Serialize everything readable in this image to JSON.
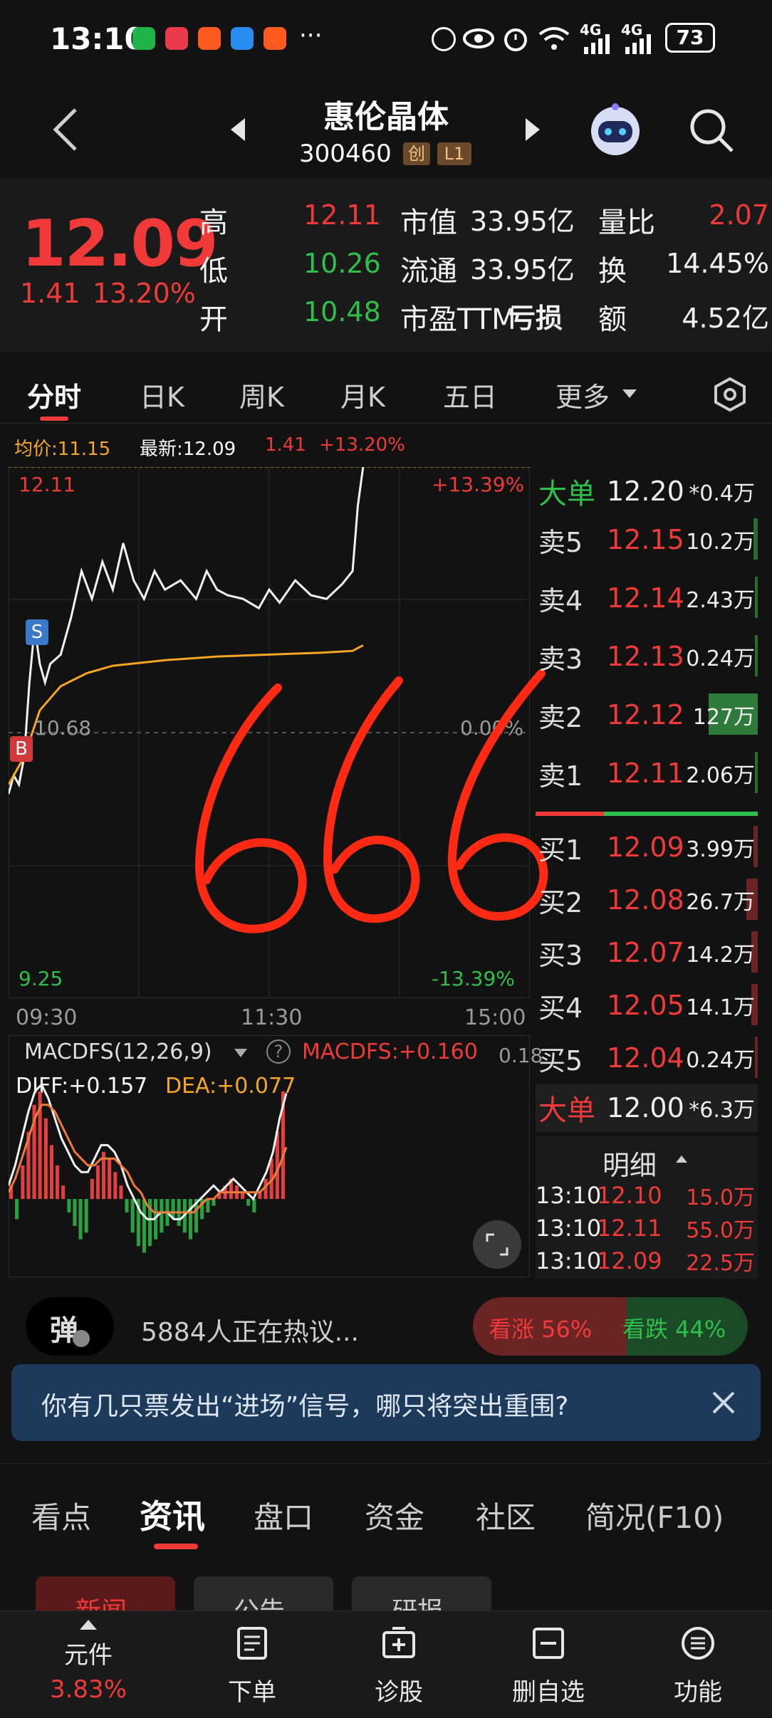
{
  "status_bar": {
    "time": "13:10",
    "signal_1": "4G",
    "signal_2": "4G",
    "battery": "73"
  },
  "nav": {
    "stock_name": "惠伦晶体",
    "stock_code": "300460",
    "badge_board": "创",
    "badge_level": "L1"
  },
  "quote": {
    "price": "12.09",
    "change": "1.41",
    "change_pct": "13.20%",
    "rows": [
      {
        "l1": "高",
        "v1": "12.11",
        "l2": "市值",
        "v2": "33.95亿",
        "l3": "量比",
        "v3": "2.07"
      },
      {
        "l1": "低",
        "v1": "10.26",
        "l2": "流通",
        "v2": "33.95亿",
        "l3": "换",
        "v3": "14.45%"
      },
      {
        "l1": "开",
        "v1": "10.48",
        "l2": "市盈TTM",
        "v2": "亏损",
        "l3": "额",
        "v3": "4.52亿"
      }
    ],
    "colors": {
      "up": "#f03a3a",
      "down": "#2fbf4a"
    }
  },
  "chart_tabs": [
    "分时",
    "日K",
    "周K",
    "月K",
    "五日",
    "更多"
  ],
  "chart_tabs_active": 0,
  "intraday": {
    "avg_label": "均价:11.15",
    "latest_label": "最新:12.09",
    "latest_change": "1.41",
    "latest_pct": "+13.20%",
    "price_top": "12.11",
    "price_mid": "10.68",
    "price_bottom": "9.25",
    "pct_top": "+13.39%",
    "pct_mid": "0.00%",
    "pct_bottom": "-13.39%",
    "time_start": "09:30",
    "time_mid": "11:30",
    "time_end": "15:00",
    "marker_sell": "S",
    "marker_buy": "B",
    "annotation": "666"
  },
  "chart_data": {
    "type": "line",
    "title": "",
    "series": [
      {
        "name": "最新",
        "color": "#f2f2f2",
        "points": [
          [
            0,
            10.35
          ],
          [
            0.01,
            10.45
          ],
          [
            0.02,
            10.4
          ],
          [
            0.03,
            10.55
          ],
          [
            0.04,
            10.95
          ],
          [
            0.05,
            11.25
          ],
          [
            0.06,
            11.05
          ],
          [
            0.07,
            10.95
          ],
          [
            0.08,
            11.05
          ],
          [
            0.1,
            11.1
          ],
          [
            0.12,
            11.3
          ],
          [
            0.14,
            11.55
          ],
          [
            0.16,
            11.4
          ],
          [
            0.18,
            11.6
          ],
          [
            0.2,
            11.45
          ],
          [
            0.22,
            11.7
          ],
          [
            0.24,
            11.5
          ],
          [
            0.26,
            11.4
          ],
          [
            0.28,
            11.55
          ],
          [
            0.3,
            11.45
          ],
          [
            0.33,
            11.5
          ],
          [
            0.36,
            11.4
          ],
          [
            0.38,
            11.55
          ],
          [
            0.4,
            11.45
          ],
          [
            0.42,
            11.42
          ],
          [
            0.45,
            11.4
          ],
          [
            0.48,
            11.35
          ],
          [
            0.5,
            11.45
          ],
          [
            0.52,
            11.38
          ],
          [
            0.55,
            11.5
          ],
          [
            0.58,
            11.42
          ],
          [
            0.61,
            11.4
          ],
          [
            0.64,
            11.48
          ],
          [
            0.66,
            11.55
          ],
          [
            0.67,
            11.9
          ],
          [
            0.68,
            12.11
          ]
        ]
      },
      {
        "name": "均价",
        "color": "#f5a623",
        "points": [
          [
            0,
            10.4
          ],
          [
            0.03,
            10.55
          ],
          [
            0.06,
            10.8
          ],
          [
            0.1,
            10.93
          ],
          [
            0.15,
            11.0
          ],
          [
            0.2,
            11.04
          ],
          [
            0.3,
            11.07
          ],
          [
            0.4,
            11.09
          ],
          [
            0.5,
            11.1
          ],
          [
            0.6,
            11.11
          ],
          [
            0.66,
            11.12
          ],
          [
            0.68,
            11.15
          ]
        ]
      }
    ],
    "ylim": [
      9.25,
      12.11
    ],
    "xlim": [
      0,
      1
    ],
    "x_ticks": [
      "09:30",
      "11:30",
      "15:00"
    ]
  },
  "macd": {
    "label": "MACDFS(12,26,9)",
    "value_label": "MACDFS:+0.160",
    "right_tick": "0.18",
    "diff_label": "DIFF:+0.157",
    "dea_label": "DEA:+0.077",
    "bars": [
      0.02,
      -0.03,
      0.05,
      0.1,
      0.14,
      0.16,
      0.12,
      0.08,
      0.05,
      0.02,
      -0.02,
      -0.04,
      -0.06,
      -0.05,
      0.03,
      0.05,
      0.07,
      0.06,
      0.04,
      0.02,
      -0.02,
      -0.05,
      -0.07,
      -0.08,
      -0.07,
      -0.06,
      -0.05,
      -0.04,
      -0.03,
      -0.04,
      -0.05,
      -0.06,
      -0.05,
      -0.03,
      -0.02,
      -0.01,
      0.01,
      0.02,
      0.03,
      0.02,
      0.01,
      -0.01,
      -0.02,
      0.01,
      0.03,
      0.06,
      0.1,
      0.16
    ],
    "diff": [
      0.02,
      0.05,
      0.09,
      0.13,
      0.16,
      0.17,
      0.15,
      0.12,
      0.09,
      0.07,
      0.05,
      0.04,
      0.04,
      0.06,
      0.08,
      0.08,
      0.07,
      0.05,
      0.02,
      0.0,
      -0.02,
      -0.03,
      -0.03,
      -0.02,
      -0.02,
      -0.03,
      -0.03,
      -0.02,
      -0.01,
      0.0,
      0.01,
      0.02,
      0.01,
      0.02,
      0.03,
      0.02,
      0.01,
      0.0,
      0.02,
      0.04,
      0.07,
      0.12,
      0.157
    ],
    "dea": [
      0.01,
      0.03,
      0.06,
      0.09,
      0.12,
      0.14,
      0.14,
      0.13,
      0.11,
      0.09,
      0.07,
      0.06,
      0.05,
      0.05,
      0.06,
      0.06,
      0.06,
      0.05,
      0.04,
      0.02,
      0.01,
      -0.01,
      -0.02,
      -0.02,
      -0.02,
      -0.02,
      -0.02,
      -0.02,
      -0.02,
      -0.01,
      0.0,
      0.0,
      0.01,
      0.01,
      0.01,
      0.01,
      0.01,
      0.01,
      0.01,
      0.02,
      0.03,
      0.05,
      0.077
    ]
  },
  "orderbook": {
    "big_sell": {
      "label": "大单",
      "price": "12.20",
      "vol": "*0.4万"
    },
    "asks": [
      {
        "label": "卖5",
        "price": "12.15",
        "vol": "10.2万",
        "bar": 0.02
      },
      {
        "label": "卖4",
        "price": "12.14",
        "vol": "2.43万",
        "bar": 0.01
      },
      {
        "label": "卖3",
        "price": "12.13",
        "vol": "0.24万",
        "bar": 0.005
      },
      {
        "label": "卖2",
        "price": "12.12",
        "vol": "127万",
        "bar": 0.22
      },
      {
        "label": "卖1",
        "price": "12.11",
        "vol": "2.06万",
        "bar": 0.01
      }
    ],
    "bids": [
      {
        "label": "买1",
        "price": "12.09",
        "vol": "3.99万",
        "bar": 0.02
      },
      {
        "label": "买2",
        "price": "12.08",
        "vol": "26.7万",
        "bar": 0.05
      },
      {
        "label": "买3",
        "price": "12.07",
        "vol": "14.2万",
        "bar": 0.03
      },
      {
        "label": "买4",
        "price": "12.05",
        "vol": "14.1万",
        "bar": 0.03
      },
      {
        "label": "买5",
        "price": "12.04",
        "vol": "0.24万",
        "bar": 0.005
      }
    ],
    "big_buy": {
      "label": "大单",
      "price": "12.00",
      "vol": "*6.3万"
    },
    "detail_title": "明细",
    "details": [
      {
        "time": "13:10",
        "price": "12.10",
        "vol": "15.0万"
      },
      {
        "time": "13:10",
        "price": "12.11",
        "vol": "55.0万"
      },
      {
        "time": "13:10",
        "price": "12.09",
        "vol": "22.5万"
      }
    ]
  },
  "discussion": {
    "danmu_label": "弹",
    "text": "5884人正在热议...",
    "up_label": "看涨 56%",
    "down_label": "看跌 44%",
    "up_fraction": 0.56
  },
  "banner": {
    "text": "你有几只票发出“进场”信号，哪只将突出重围?"
  },
  "content_tabs": [
    "看点",
    "资讯",
    "盘口",
    "资金",
    "社区",
    "简况(F10)"
  ],
  "content_tabs_active": 1,
  "sub_tabs": [
    "新闻",
    "公告",
    "研报"
  ],
  "bottom_bar": {
    "widget_label": "元件",
    "widget_value": "3.83%",
    "items": [
      "下单",
      "诊股",
      "删自选",
      "功能"
    ]
  }
}
